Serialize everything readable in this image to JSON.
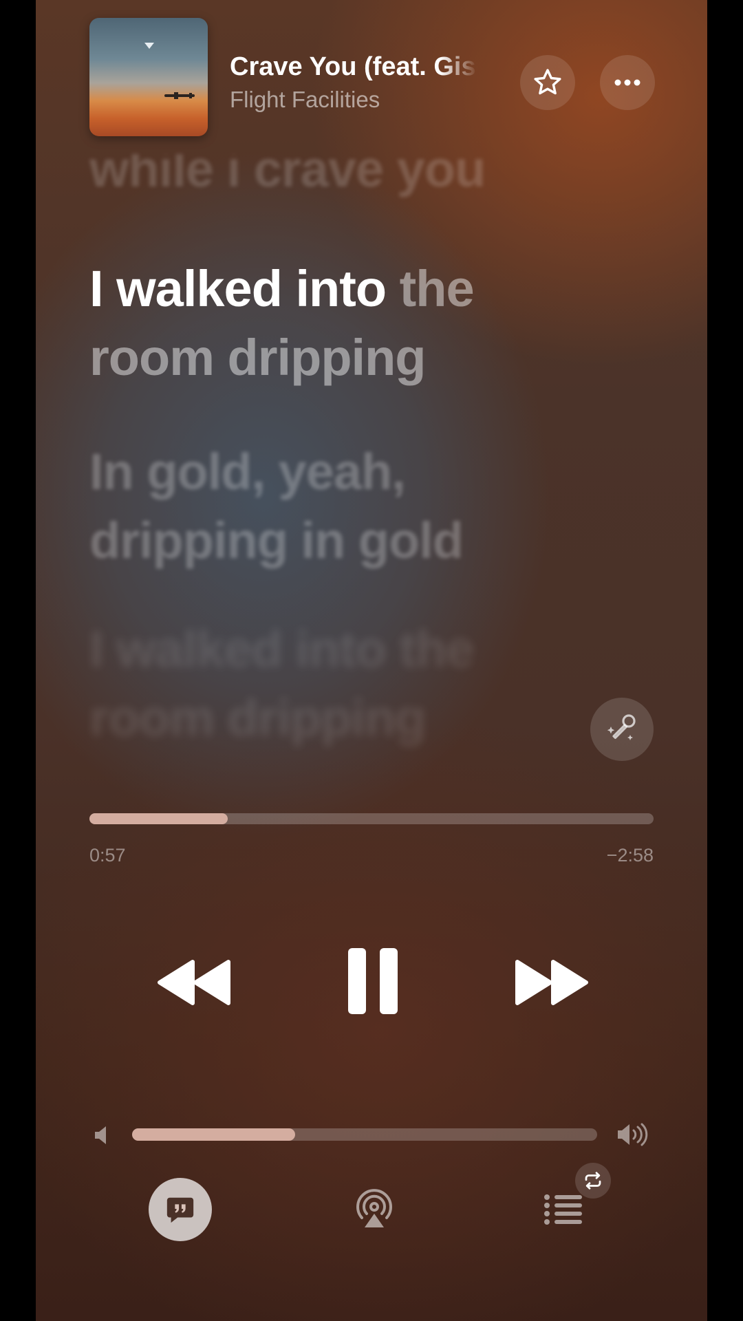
{
  "now_playing": {
    "title": "Crave You (feat. Giselle)",
    "artist": "Flight Facilities",
    "artwork_icon": "album-artwork"
  },
  "header_actions": {
    "favorite_icon": "star-icon",
    "more_icon": "ellipsis-icon"
  },
  "lyrics": {
    "previous": "while i crave you",
    "active_sung": "I walked into",
    "active_sung_partial": " the",
    "active_line2": "room dripping",
    "next_1_line1": "In gold, yeah,",
    "next_1_line2": "dripping in gold",
    "next_2_line1": "I walked into the",
    "next_2_line2": "room dripping",
    "mic_icon": "sing-mic-icon"
  },
  "playback": {
    "elapsed": "0:57",
    "remaining": "−2:58",
    "progress_fraction": 0.245
  },
  "transport": {
    "rewind_icon": "rewind-icon",
    "pause_icon": "pause-icon",
    "forward_icon": "fast-forward-icon"
  },
  "volume": {
    "level_fraction": 0.35,
    "low_icon": "speaker-low-icon",
    "high_icon": "speaker-high-icon"
  },
  "bottom_bar": {
    "lyrics_icon": "lyrics-quote-icon",
    "airplay_icon": "airplay-icon",
    "queue_icon": "queue-list-icon",
    "repeat_icon": "repeat-icon"
  },
  "colors": {
    "accent": "#d4ada0",
    "text_primary": "#ffffff"
  }
}
